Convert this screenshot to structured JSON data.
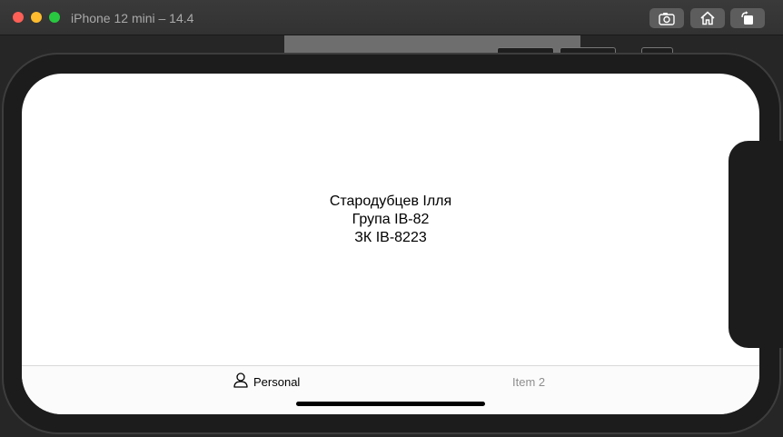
{
  "window": {
    "title": "iPhone 12 mini – 14.4",
    "toolbar": {
      "screenshot_icon": "camera-icon",
      "home_icon": "home-icon",
      "rotate_icon": "rotate-icon"
    }
  },
  "app": {
    "content": {
      "name_line": "Стародубцев Ілля",
      "group_line": "Група ІВ-82",
      "record_line": "ЗК ІВ-8223"
    },
    "tabs": [
      {
        "label": "Personal",
        "icon": "person-icon",
        "selected": true
      },
      {
        "label": "Item 2",
        "selected": false
      }
    ]
  },
  "colors": {
    "traffic_red": "#fe5f57",
    "traffic_yellow": "#febc2e",
    "traffic_green": "#28c840",
    "tab_selected": "#000000",
    "tab_unselected": "#8e8e8e"
  }
}
